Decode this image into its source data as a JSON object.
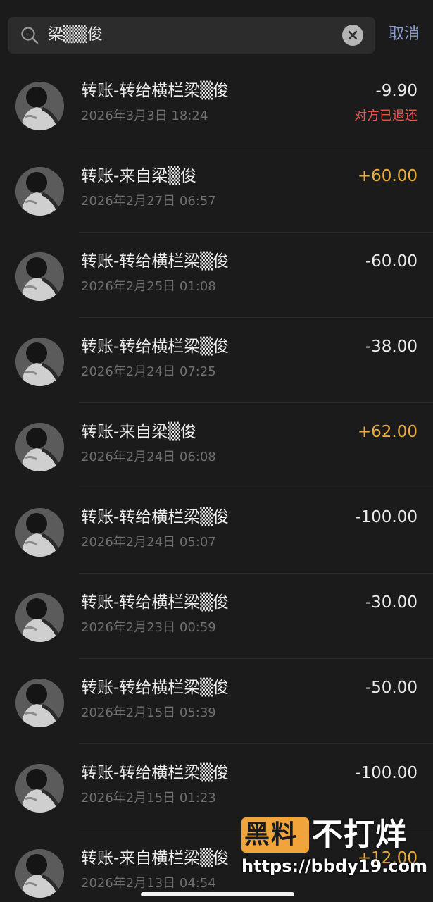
{
  "search": {
    "query": "梁▒▒俊",
    "cancel_label": "取消",
    "icon": "search-icon",
    "clear_icon": "clear-icon"
  },
  "colors": {
    "expense": "#ececec",
    "income": "#e8ac3c",
    "refunded": "#e8534a"
  },
  "transactions": [
    {
      "title": "转账-转给横栏梁▒俊",
      "time": "2026年3月3日 18:24",
      "amount": "-9.90",
      "type": "expense",
      "status": "对方已退还"
    },
    {
      "title": "转账-来自梁▒俊",
      "time": "2026年2月27日 06:57",
      "amount": "+60.00",
      "type": "income",
      "status": ""
    },
    {
      "title": "转账-转给横栏梁▒俊",
      "time": "2026年2月25日 01:08",
      "amount": "-60.00",
      "type": "expense",
      "status": ""
    },
    {
      "title": "转账-转给横栏梁▒俊",
      "time": "2026年2月24日 07:25",
      "amount": "-38.00",
      "type": "expense",
      "status": ""
    },
    {
      "title": "转账-来自梁▒俊",
      "time": "2026年2月24日 06:08",
      "amount": "+62.00",
      "type": "income",
      "status": ""
    },
    {
      "title": "转账-转给横栏梁▒俊",
      "time": "2026年2月24日 05:07",
      "amount": "-100.00",
      "type": "expense",
      "status": ""
    },
    {
      "title": "转账-转给横栏梁▒俊",
      "time": "2026年2月23日 00:59",
      "amount": "-30.00",
      "type": "expense",
      "status": ""
    },
    {
      "title": "转账-转给横栏梁▒俊",
      "time": "2026年2月15日 05:39",
      "amount": "-50.00",
      "type": "expense",
      "status": ""
    },
    {
      "title": "转账-转给横栏梁▒俊",
      "time": "2026年2月15日 01:23",
      "amount": "-100.00",
      "type": "expense",
      "status": ""
    },
    {
      "title": "转账-来自横栏梁▒俊",
      "time": "2026年2月13日 04:54",
      "amount": "+12.00",
      "type": "income",
      "status": ""
    }
  ],
  "watermark": {
    "logo": "黑料",
    "name": "不打烊",
    "url": "https://bbdy19.com"
  }
}
